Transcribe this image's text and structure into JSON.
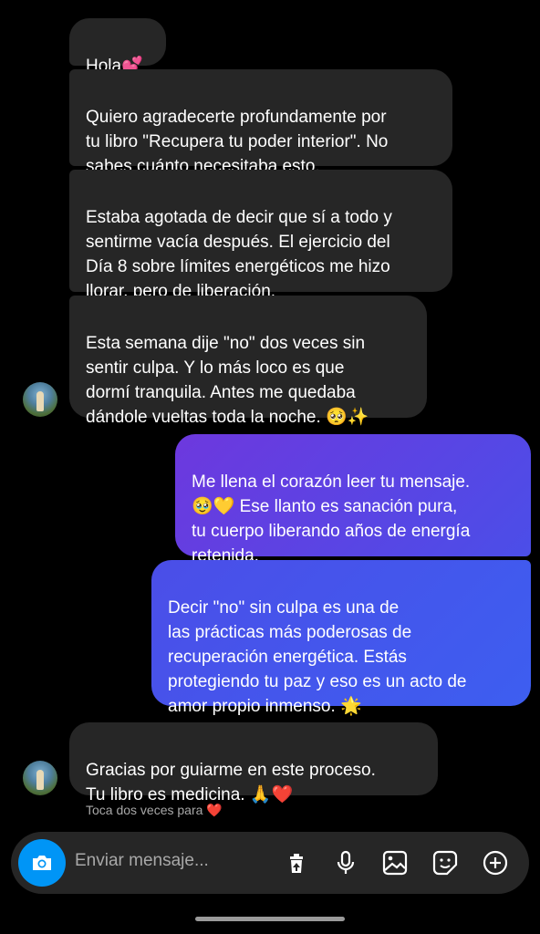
{
  "colors": {
    "incoming_bubble": "#262626",
    "outgoing_gradient_start": "#6a3be0",
    "outgoing_gradient_end": "#3d5bf0",
    "camera_button": "#0095f6",
    "background": "#000000"
  },
  "messages": [
    {
      "direction": "incoming",
      "text": "Hola💕"
    },
    {
      "direction": "incoming",
      "text": "Quiero agradecerte profundamente por\ntu libro \"Recupera tu poder interior\". No\nsabes cuánto necesitaba esto."
    },
    {
      "direction": "incoming",
      "text": "Estaba agotada de decir que sí a todo y\nsentirme vacía después. El ejercicio del\nDía 8 sobre límites energéticos me hizo\nllorar, pero de liberación."
    },
    {
      "direction": "incoming",
      "text": "Esta semana dije \"no\" dos veces sin\nsentir culpa. Y lo más loco es que\ndormí tranquila. Antes me quedaba\ndándole vueltas toda la noche. 🥺✨"
    },
    {
      "direction": "outgoing",
      "text": "Me llena el corazón leer tu mensaje.\n🥹💛 Ese llanto es sanación pura,\ntu cuerpo liberando años de energía\nretenida."
    },
    {
      "direction": "outgoing",
      "text": "Decir \"no\" sin culpa es una de\nlas prácticas más poderosas de\nrecuperación energética. Estás\nprotegiendo tu paz y eso es un acto de\namor propio inmenso. 🌟"
    },
    {
      "direction": "incoming",
      "text": "Gracias por guiarme en este proceso.\nTu libro es medicina. 🙏❤️"
    }
  ],
  "hint": "Toca dos veces para ❤️",
  "composer": {
    "placeholder": "Enviar mensaje...",
    "icons": [
      "camera-icon",
      "sticker-trash-icon",
      "microphone-icon",
      "gallery-icon",
      "sticker-icon",
      "add-icon"
    ]
  }
}
